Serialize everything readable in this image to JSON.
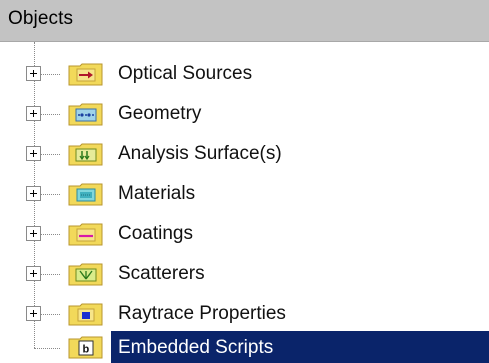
{
  "panel": {
    "title": "Objects"
  },
  "tree": {
    "items": [
      {
        "label": "Optical Sources",
        "icon": "optical-sources-folder-icon",
        "expandable": true,
        "selected": false
      },
      {
        "label": "Geometry",
        "icon": "geometry-folder-icon",
        "expandable": true,
        "selected": false
      },
      {
        "label": "Analysis Surface(s)",
        "icon": "analysis-surface-folder-icon",
        "expandable": true,
        "selected": false
      },
      {
        "label": "Materials",
        "icon": "materials-folder-icon",
        "expandable": true,
        "selected": false
      },
      {
        "label": "Coatings",
        "icon": "coatings-folder-icon",
        "expandable": true,
        "selected": false
      },
      {
        "label": "Scatterers",
        "icon": "scatterers-folder-icon",
        "expandable": true,
        "selected": false
      },
      {
        "label": "Raytrace Properties",
        "icon": "raytrace-properties-folder-icon",
        "expandable": true,
        "selected": false
      },
      {
        "label": "Embedded Scripts",
        "icon": "embedded-scripts-folder-icon",
        "expandable": false,
        "selected": true
      }
    ]
  },
  "colors": {
    "header_bg": "#c3c3c3",
    "selection_bg": "#0a246a",
    "folder_yellow": "#f2d95a",
    "folder_edge": "#b8962e"
  }
}
